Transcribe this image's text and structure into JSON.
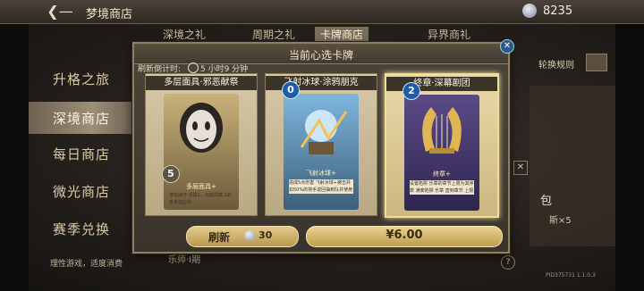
{
  "topbar": {
    "title": "梦境商店",
    "gem_count": "8235"
  },
  "sidebar": {
    "items": [
      {
        "label": "升格之旅"
      },
      {
        "label": "深境商店"
      },
      {
        "label": "每日商店"
      },
      {
        "label": "微光商店"
      },
      {
        "label": "赛季兑换"
      }
    ],
    "footer": "理性游戏，适度消费"
  },
  "bg_tabs": [
    "深境之礼",
    "周期之礼",
    "卡牌商店",
    "异界商礼"
  ],
  "bg": {
    "switch_rule": "轮换规则",
    "bao": "包",
    "x5": "斯×5",
    "yueshi": "乐师·I期",
    "version": "PID375731 1.1.0.3"
  },
  "modal": {
    "title": "当前心选卡牌",
    "timer_label": "刷新倒计时:",
    "timer_value": "5 小时9 分钟",
    "cards": [
      {
        "name": "多层面具·邪恶献祭",
        "cost": "5",
        "label": "多层面具+",
        "desc": "潜在破坏:清除1，完成成数:1的金身加左侧"
      },
      {
        "name": "飞射冰球·涂鸦朋克",
        "cost": "0",
        "label": "飞射冰球+",
        "desc": "造成5点伤害  飞射冰球+被击并扣50%的将手返回抽到队并使用"
      },
      {
        "name": "终章·深幕剧团",
        "cost": "2",
        "label": "终章+",
        "desc": "设置陷阱 乐章的章节上限为其序数  满奏陷阱 乐章 直到章节 上限"
      }
    ],
    "refresh_label": "刷新",
    "refresh_cost": "30",
    "price": "¥6.00"
  },
  "colors": {
    "accent": "#f2dd93",
    "cost_blue": "#1f5ca8"
  }
}
